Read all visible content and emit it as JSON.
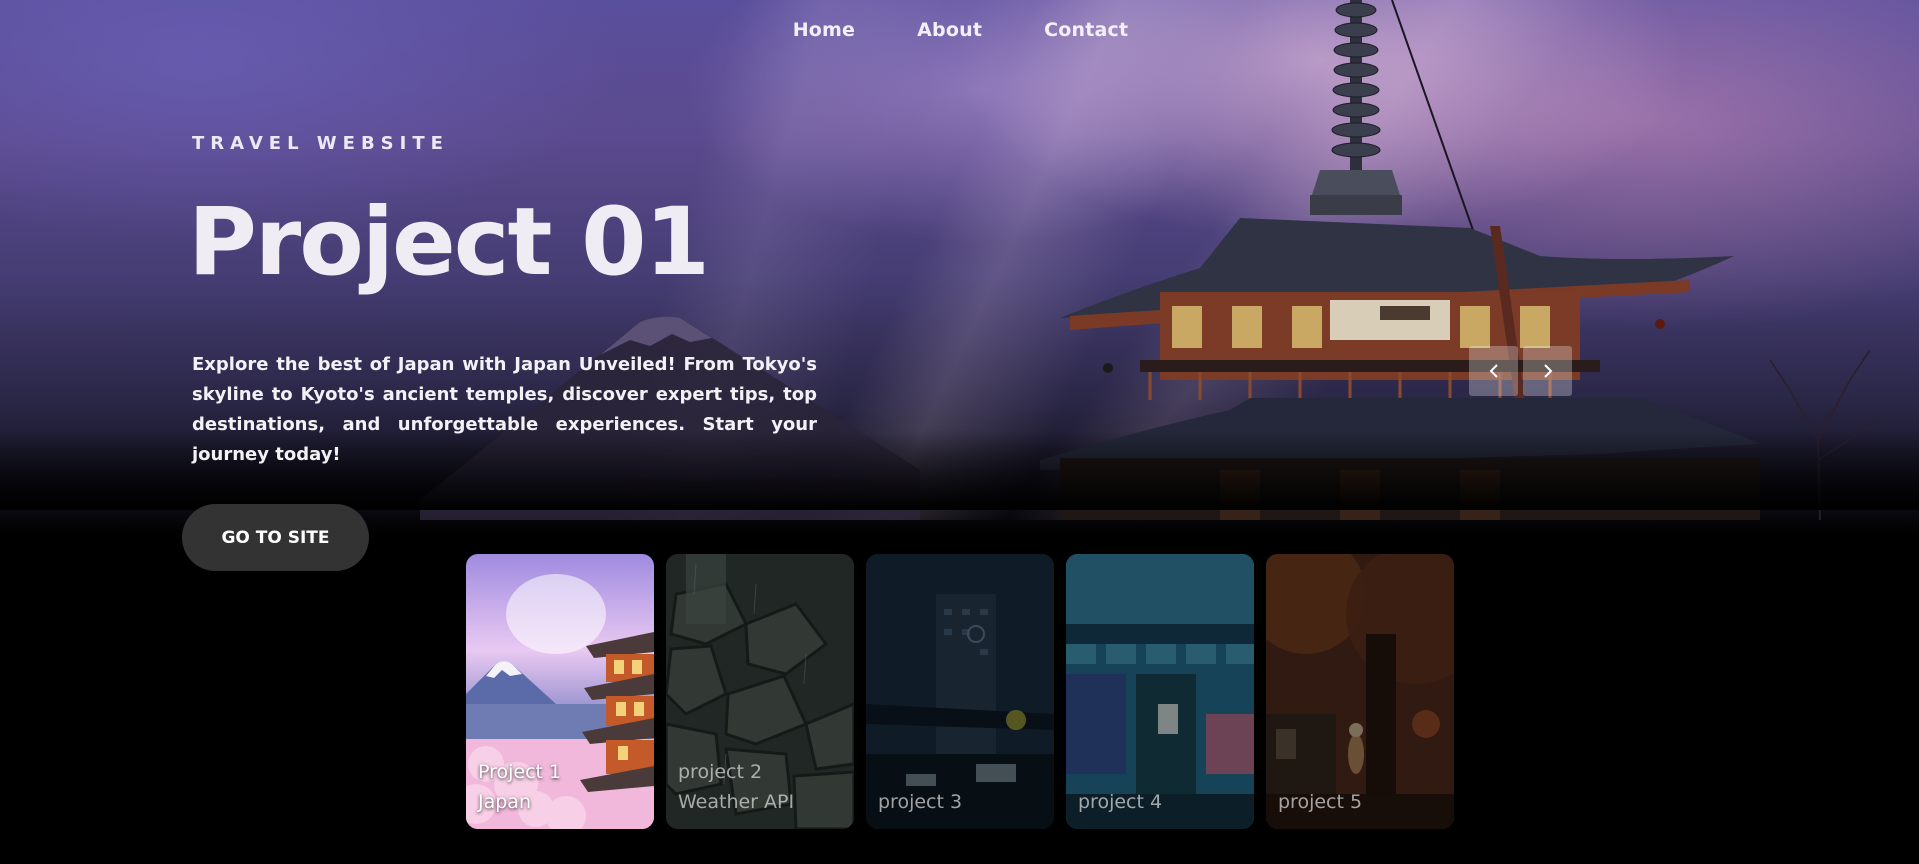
{
  "nav": {
    "items": [
      {
        "label": "Home"
      },
      {
        "label": "About"
      },
      {
        "label": "Contact"
      }
    ]
  },
  "hero": {
    "eyebrow": "TRAVEL WEBSITE",
    "title": "Project 01",
    "description": "Explore the best of Japan with Japan Unveiled! From Tokyo's skyline to Kyoto's ancient temples, discover expert tips, top destinations, and unforgettable experiences. Start your journey today!",
    "cta_label": "GO TO SITE"
  },
  "slider": {
    "prev_icon": "chevron-left-icon",
    "next_icon": "chevron-right-icon"
  },
  "thumbnails": [
    {
      "line1": "Project 1",
      "line2": "Japan",
      "active": true
    },
    {
      "line1": "project 2",
      "line2": "Weather API",
      "active": false
    },
    {
      "line1": "",
      "line2": "project 3",
      "active": false
    },
    {
      "line1": "",
      "line2": "project 4",
      "active": false
    },
    {
      "line1": "",
      "line2": "project 5",
      "active": false
    }
  ],
  "colors": {
    "background": "#000000",
    "cta_background": "#333333",
    "text": "#ffffff",
    "sky_top": "#5a4f9c"
  }
}
